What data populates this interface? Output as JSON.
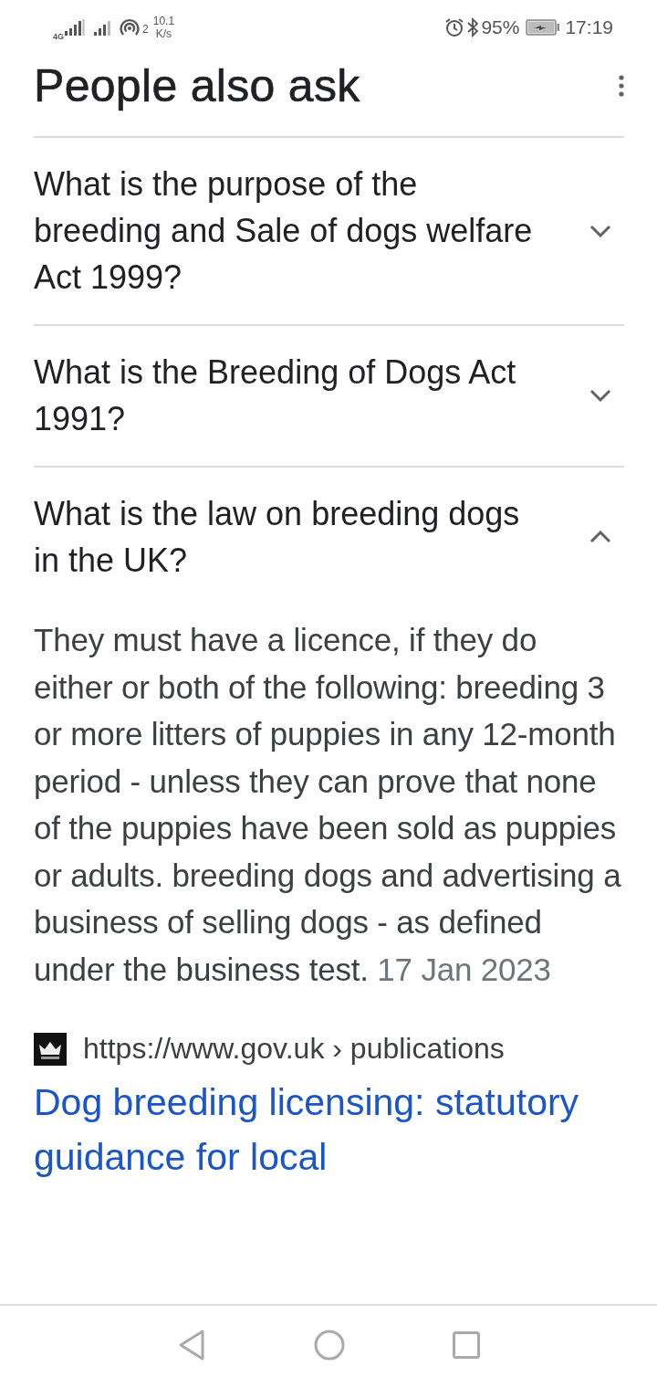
{
  "status_bar": {
    "network_label": "4G",
    "hotspot_count": "2",
    "speed_value": "10.1",
    "speed_unit": "K/s",
    "battery": "95%",
    "time": "17:19"
  },
  "section": {
    "title": "People also ask"
  },
  "questions": [
    {
      "text": "What is the purpose of the breeding and Sale of dogs welfare Act 1999?",
      "expanded": false
    },
    {
      "text": "What is the Breeding of Dogs Act 1991?",
      "expanded": false
    },
    {
      "text": "What is the law on breeding dogs in the UK?",
      "expanded": true
    }
  ],
  "answer": {
    "text": "They must have a licence, if they do either or both of the following: breeding 3 or more litters of puppies in any 12-month period - unless they can prove that none of the puppies have been sold as puppies or adults. breeding dogs and advertising a business of selling dogs - as defined under the business test.",
    "date": "17 Jan 2023"
  },
  "source": {
    "url": "https://www.gov.uk › publications",
    "title": "Dog breeding licensing: statutory guidance for local"
  }
}
